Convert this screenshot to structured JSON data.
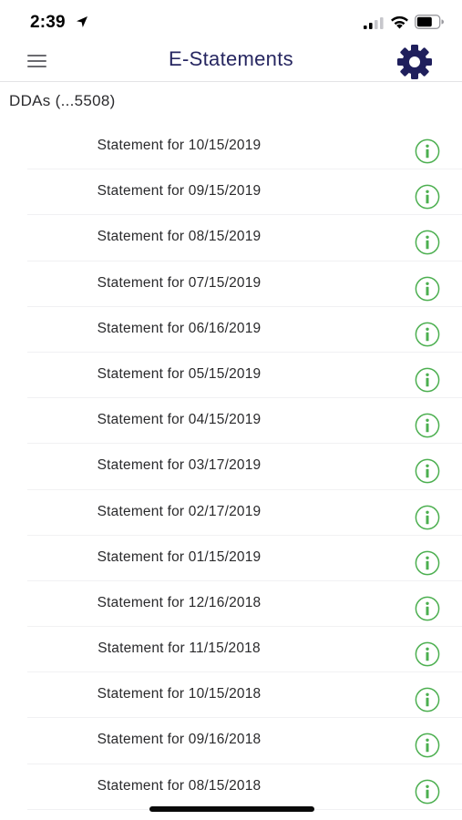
{
  "status_bar": {
    "time": "2:39",
    "location_icon": "location-arrow-icon",
    "signal_icon": "cellular-signal-icon",
    "wifi_icon": "wifi-icon",
    "battery_icon": "battery-icon"
  },
  "nav": {
    "title": "E-Statements",
    "menu_icon": "hamburger-menu-icon",
    "settings_icon": "gear-icon",
    "title_color": "#272761",
    "settings_color": "#1f1f5c"
  },
  "account": {
    "label": "DDAs  (...5508)"
  },
  "statements": [
    {
      "label": "Statement for 10/15/2019"
    },
    {
      "label": "Statement for 09/15/2019"
    },
    {
      "label": "Statement for 08/15/2019"
    },
    {
      "label": "Statement for 07/15/2019"
    },
    {
      "label": "Statement for 06/16/2019"
    },
    {
      "label": "Statement for 05/15/2019"
    },
    {
      "label": "Statement for 04/15/2019"
    },
    {
      "label": "Statement for 03/17/2019"
    },
    {
      "label": "Statement for 02/17/2019"
    },
    {
      "label": "Statement for 01/15/2019"
    },
    {
      "label": "Statement for 12/16/2018"
    },
    {
      "label": "Statement for 11/15/2018"
    },
    {
      "label": "Statement for 10/15/2018"
    },
    {
      "label": "Statement for 09/16/2018"
    },
    {
      "label": "Statement for 08/15/2018"
    }
  ],
  "info_icon": "info-circle-icon",
  "info_icon_color": "#4caf50"
}
